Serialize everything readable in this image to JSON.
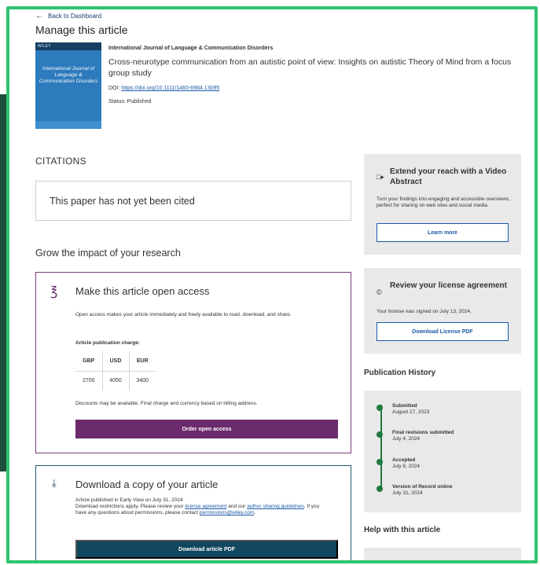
{
  "header": {
    "back_label": "Back to Dashboard",
    "page_title": "Manage this article"
  },
  "article": {
    "cover": {
      "top_text": "WILEY",
      "title": "International Journal of Language & Communication Disorders"
    },
    "journal": "International Journal of Language & Communication Disorders",
    "title": "Cross-neurotype communication from an autistic point of view: Insights on autistic Theory of Mind from a focus group study",
    "doi_label": "DOI:",
    "doi_link": "https://doi.org/10.1111/1460-6984.13095",
    "status": "Status: Published"
  },
  "citations": {
    "heading": "CITATIONS",
    "empty_text": "This paper has not yet been cited"
  },
  "grow": {
    "heading": "Grow the impact of your research"
  },
  "open_access": {
    "title": "Make this article open access",
    "description": "Open access makes your article immediately and freely available to read, download, and share.",
    "charge_label": "Article publication charge:",
    "currencies": [
      "GBP",
      "USD",
      "EUR"
    ],
    "prices": [
      "2700",
      "4050",
      "3400"
    ],
    "note": "Discounts may be available. Final charge and currency based on billing address.",
    "button": "Order open access"
  },
  "download": {
    "title": "Download a copy of your article",
    "line1": "Article published in Early View on July 31, 2024",
    "line2_a": "Download restrictions apply. Please review your ",
    "license_link": "license agreement",
    "line2_b": " and our ",
    "sharing_link": "author sharing guidelines",
    "line2_c": ". If you have any questions about permissions, please contact ",
    "email_link": "permissions@wiley.com",
    "line2_d": ".",
    "button": "Download article PDF"
  },
  "video": {
    "title": "Extend your reach with a Video Abstract",
    "description": "Turn your findings into engaging and accessible overviews, perfect for sharing on web sites and social media.",
    "button": "Learn more"
  },
  "license": {
    "title": "Review your license agreement",
    "description": "Your license was signed on July 13, 2024.",
    "button": "Download License PDF"
  },
  "history": {
    "heading": "Publication History",
    "items": [
      {
        "label": "Submitted",
        "date": "August 27, 2023"
      },
      {
        "label": "Final revisions submitted",
        "date": "July 4, 2024"
      },
      {
        "label": "Accepted",
        "date": "July 8, 2024"
      },
      {
        "label": "Version of Record online",
        "date": "July 31, 2024"
      }
    ]
  },
  "help": {
    "heading": "Help with this article"
  },
  "colors": {
    "frame": "#2ec46f",
    "open_access_purple": "#6b2a6b",
    "download_teal": "#11475f",
    "timeline_green": "#1f7a3e",
    "link_blue": "#1b5aa8"
  }
}
